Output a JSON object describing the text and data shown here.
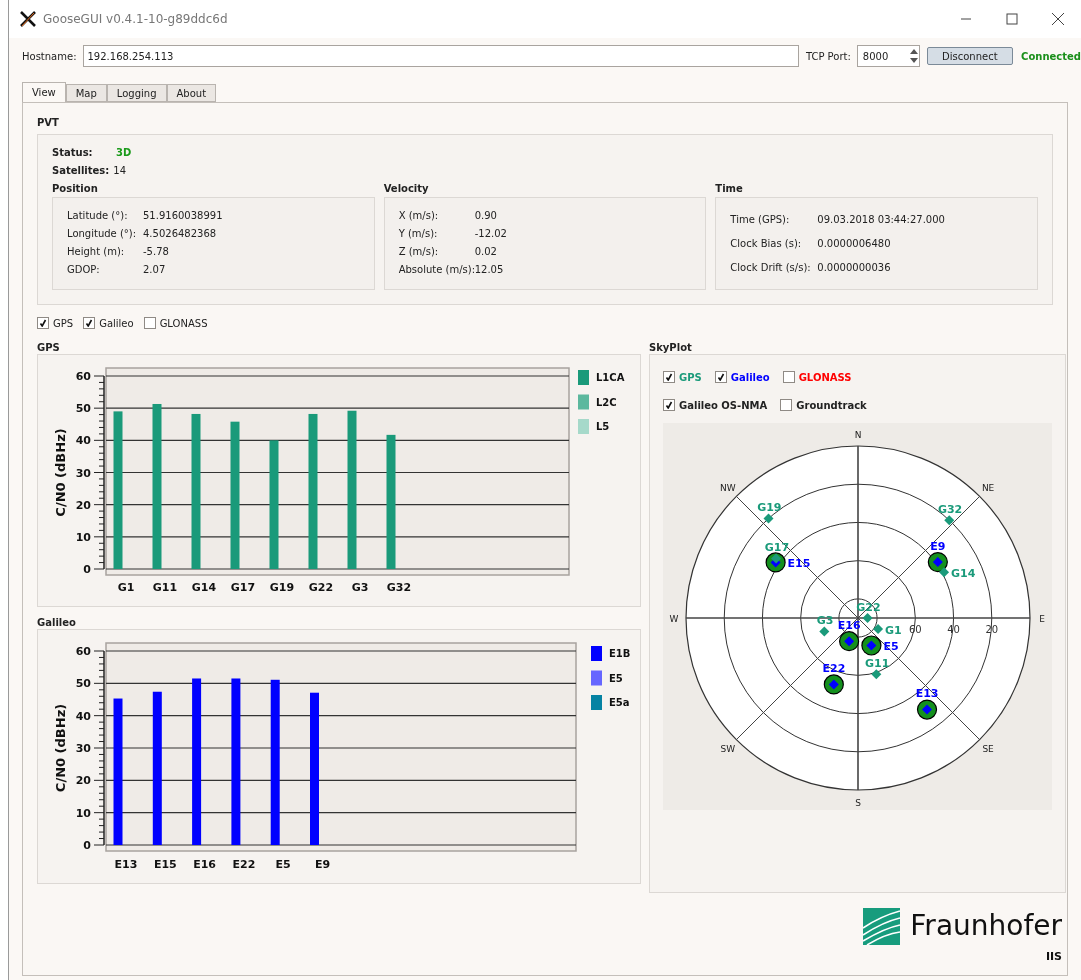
{
  "window": {
    "title": "GooseGUI v0.4.1-10-g89ddc6d"
  },
  "connection": {
    "hostname_label": "Hostname:",
    "hostname": "192.168.254.113",
    "port_label": "TCP Port:",
    "port": "8000",
    "button": "Disconnect",
    "status": "Connected"
  },
  "tabs": [
    {
      "label": "View",
      "selected": true
    },
    {
      "label": "Map",
      "selected": false
    },
    {
      "label": "Logging",
      "selected": false
    },
    {
      "label": "About",
      "selected": false
    }
  ],
  "pvt": {
    "title": "PVT",
    "status_label": "Status:",
    "status": "3D",
    "satellites_label": "Satellites:",
    "satellites": "14",
    "groups": [
      {
        "title": "Position",
        "rows": [
          {
            "label": "Latitude (°):",
            "value": "51.9160038991"
          },
          {
            "label": "Longitude (°):",
            "value": "4.5026482368"
          },
          {
            "label": "Height (m):",
            "value": "-5.78"
          },
          {
            "label": "GDOP:",
            "value": "2.07"
          }
        ]
      },
      {
        "title": "Velocity",
        "rows": [
          {
            "label": "X (m/s):",
            "value": "0.90"
          },
          {
            "label": "Y (m/s):",
            "value": "-12.02"
          },
          {
            "label": "Z (m/s):",
            "value": "0.02"
          },
          {
            "label": "Absolute (m/s):",
            "value": "12.05"
          }
        ]
      },
      {
        "title": "Time",
        "rows": [
          {
            "label": "Time (GPS):",
            "value": "09.03.2018 03:44:27.000"
          },
          {
            "label": "Clock Bias (s):",
            "value": "0.0000006480"
          },
          {
            "label": "Clock Drift (s/s):",
            "value": "0.0000000036"
          }
        ]
      }
    ]
  },
  "constellations": [
    {
      "label": "GPS",
      "checked": true
    },
    {
      "label": "Galileo",
      "checked": true
    },
    {
      "label": "GLONASS",
      "checked": false
    }
  ],
  "charts": [
    {
      "title": "GPS",
      "chart_data": {
        "type": "bar",
        "ylabel": "C/N0 (dBHz)",
        "grid": true,
        "categories": [
          "G1",
          "G11",
          "G14",
          "G17",
          "G19",
          "G22",
          "G3",
          "G32"
        ],
        "ylim": [
          0,
          60
        ],
        "yticks": [
          0,
          10,
          20,
          30,
          40,
          50,
          60
        ],
        "series": [
          {
            "name": "L1CA",
            "color": "#1a9a7a",
            "values": [
              49,
              51.3,
              48.2,
              45.8,
              40,
              48.2,
              49.2,
              41.7
            ]
          },
          {
            "name": "L2C",
            "color": "#5cb89e",
            "values": [
              null,
              null,
              null,
              null,
              null,
              null,
              null,
              null
            ]
          },
          {
            "name": "L5",
            "color": "#a6d9ca",
            "values": [
              null,
              null,
              null,
              null,
              null,
              null,
              null,
              null
            ]
          }
        ]
      }
    },
    {
      "title": "Galileo",
      "chart_data": {
        "type": "bar",
        "ylabel": "C/N0 (dBHz)",
        "grid": true,
        "categories": [
          "E13",
          "E15",
          "E16",
          "E22",
          "E5",
          "E9"
        ],
        "ylim": [
          0,
          60
        ],
        "yticks": [
          0,
          10,
          20,
          30,
          40,
          50,
          60
        ],
        "series": [
          {
            "name": "E1B",
            "color": "#0000ff",
            "values": [
              45.3,
              47.4,
              51.5,
              51.5,
              51.1,
              47.1
            ]
          },
          {
            "name": "E5",
            "color": "#6666ff",
            "values": [
              null,
              null,
              null,
              null,
              null,
              null
            ]
          },
          {
            "name": "E5a",
            "color": "#0683a3",
            "values": [
              null,
              null,
              null,
              null,
              null,
              null
            ]
          }
        ]
      }
    }
  ],
  "skyplot": {
    "title": "SkyPlot",
    "filters": [
      {
        "label": "GPS",
        "checked": true,
        "color": "#1a9a7a"
      },
      {
        "label": "Galileo",
        "checked": true,
        "color": "#0000ff"
      },
      {
        "label": "GLONASS",
        "checked": false,
        "color": "#ff0000"
      }
    ],
    "options": [
      {
        "label": "Galileo OS-NMA",
        "checked": true
      },
      {
        "label": "Groundtrack",
        "checked": false
      }
    ],
    "compass": [
      "N",
      "NE",
      "E",
      "SE",
      "S",
      "SW",
      "W",
      "NW"
    ],
    "rings": [
      "60",
      "40",
      "20"
    ],
    "satellites": [
      {
        "name": "G19",
        "color": "#1a9a7a"
      },
      {
        "name": "G32",
        "color": "#1a9a7a"
      },
      {
        "name": "G17",
        "color": "#1a9a7a"
      },
      {
        "name": "G14",
        "color": "#1a9a7a"
      },
      {
        "name": "G22",
        "color": "#1a9a7a"
      },
      {
        "name": "G1",
        "color": "#1a9a7a"
      },
      {
        "name": "G3",
        "color": "#1a9a7a"
      },
      {
        "name": "G11",
        "color": "#1a9a7a"
      },
      {
        "name": "E15",
        "color": "#0000ff"
      },
      {
        "name": "E9",
        "color": "#0000ff"
      },
      {
        "name": "E16",
        "color": "#0000ff"
      },
      {
        "name": "E5",
        "color": "#0000ff"
      },
      {
        "name": "E22",
        "color": "#0000ff"
      },
      {
        "name": "E13",
        "color": "#0000ff"
      }
    ]
  },
  "logo": {
    "name": "Fraunhofer",
    "unit": "IIS"
  }
}
